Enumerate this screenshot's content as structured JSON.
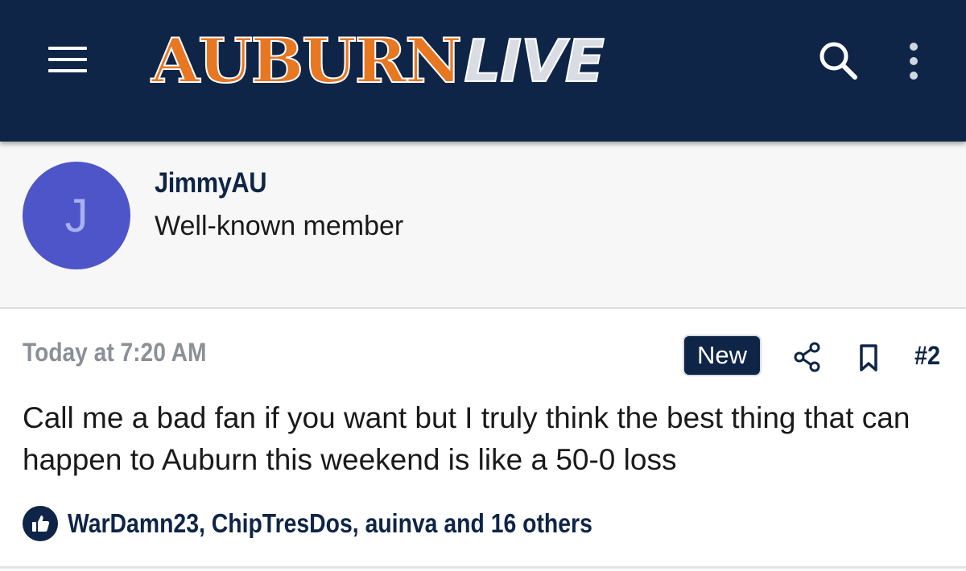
{
  "header": {
    "logo_primary": "AUBURN",
    "logo_secondary": "LIVE",
    "menu_icon": "hamburger-menu-icon",
    "search_icon": "search-icon",
    "more_icon": "vertical-ellipsis-icon",
    "background_color": "#0f2547",
    "accent_color": "#e87722"
  },
  "author": {
    "avatar_letter": "J",
    "avatar_color": "#4d55c8",
    "name": "JimmyAU",
    "title": "Well-known member"
  },
  "post": {
    "timestamp": "Today at 7:20 AM",
    "badge": "New",
    "share_icon": "share-icon",
    "bookmark_icon": "bookmark-icon",
    "number": "#2",
    "body": "Call me a bad fan if you want but I truly think the best thing that can happen to Auburn this weekend is like a 50-0 loss",
    "reactions": {
      "icon": "thumbs-up-icon",
      "text": "WarDamn23, ChipTresDos, auinva and 16 others"
    }
  }
}
